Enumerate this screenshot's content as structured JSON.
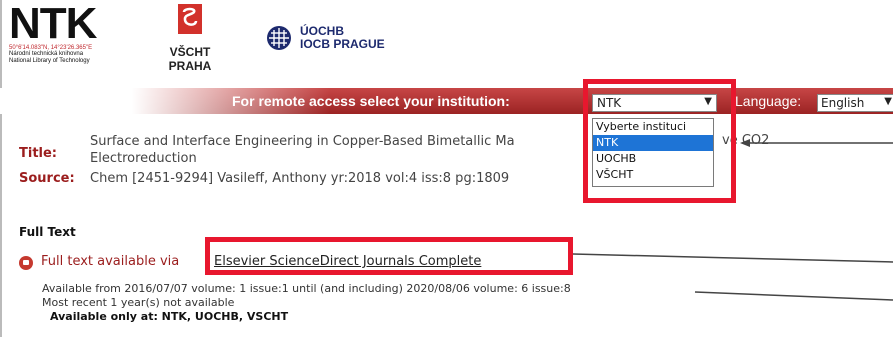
{
  "header": {
    "ntk_logo": {
      "mark": "NTK",
      "coords": "50°6'14.083\"N, 14°23'26.365\"E",
      "line1": "Národní technická knihovna",
      "line2": "National Library of Technology"
    },
    "vscht_logo": {
      "text": "VŠCHT PRAHA",
      "color": "#d2312b"
    },
    "uochb_logo": {
      "line1": "ÚOCHB",
      "line2": "IOCB PRAGUE",
      "color": "#1d2a6e"
    }
  },
  "access_bar": {
    "label": "For remote access select your institution:",
    "institution_selected": "NTK",
    "language_label": "Language:",
    "language_selected": "English",
    "bar_color": "#a82c2c"
  },
  "institution_dropdown": {
    "options": [
      "Vyberte instituci",
      "NTK",
      "UOCHB",
      "VŠCHT"
    ],
    "highlighted": "NTK",
    "highlight_color": "#1e74d6"
  },
  "record": {
    "title_label": "Title:",
    "title_line1": "Surface and Interface Engineering in Copper-Based Bimetallic Ma",
    "title_line2": "Electroreduction",
    "title_tail": "ve CO2",
    "source_label": "Source:",
    "source_value": "Chem [2451-9294] Vasileff, Anthony yr:2018 vol:4 iss:8 pg:1809"
  },
  "full_text": {
    "heading": "Full Text",
    "available_via": "Full text available via",
    "link_label": "Elsevier ScienceDirect Journals Complete",
    "availability_line": "Available from 2016/07/07 volume: 1 issue:1 until (and including) 2020/08/06 volume: 6 issue:8",
    "recent_line": "Most recent 1 year(s) not available",
    "available_at": "Available only at: NTK, UOCHB, VSCHT"
  },
  "annotation_color": "#e8172e"
}
